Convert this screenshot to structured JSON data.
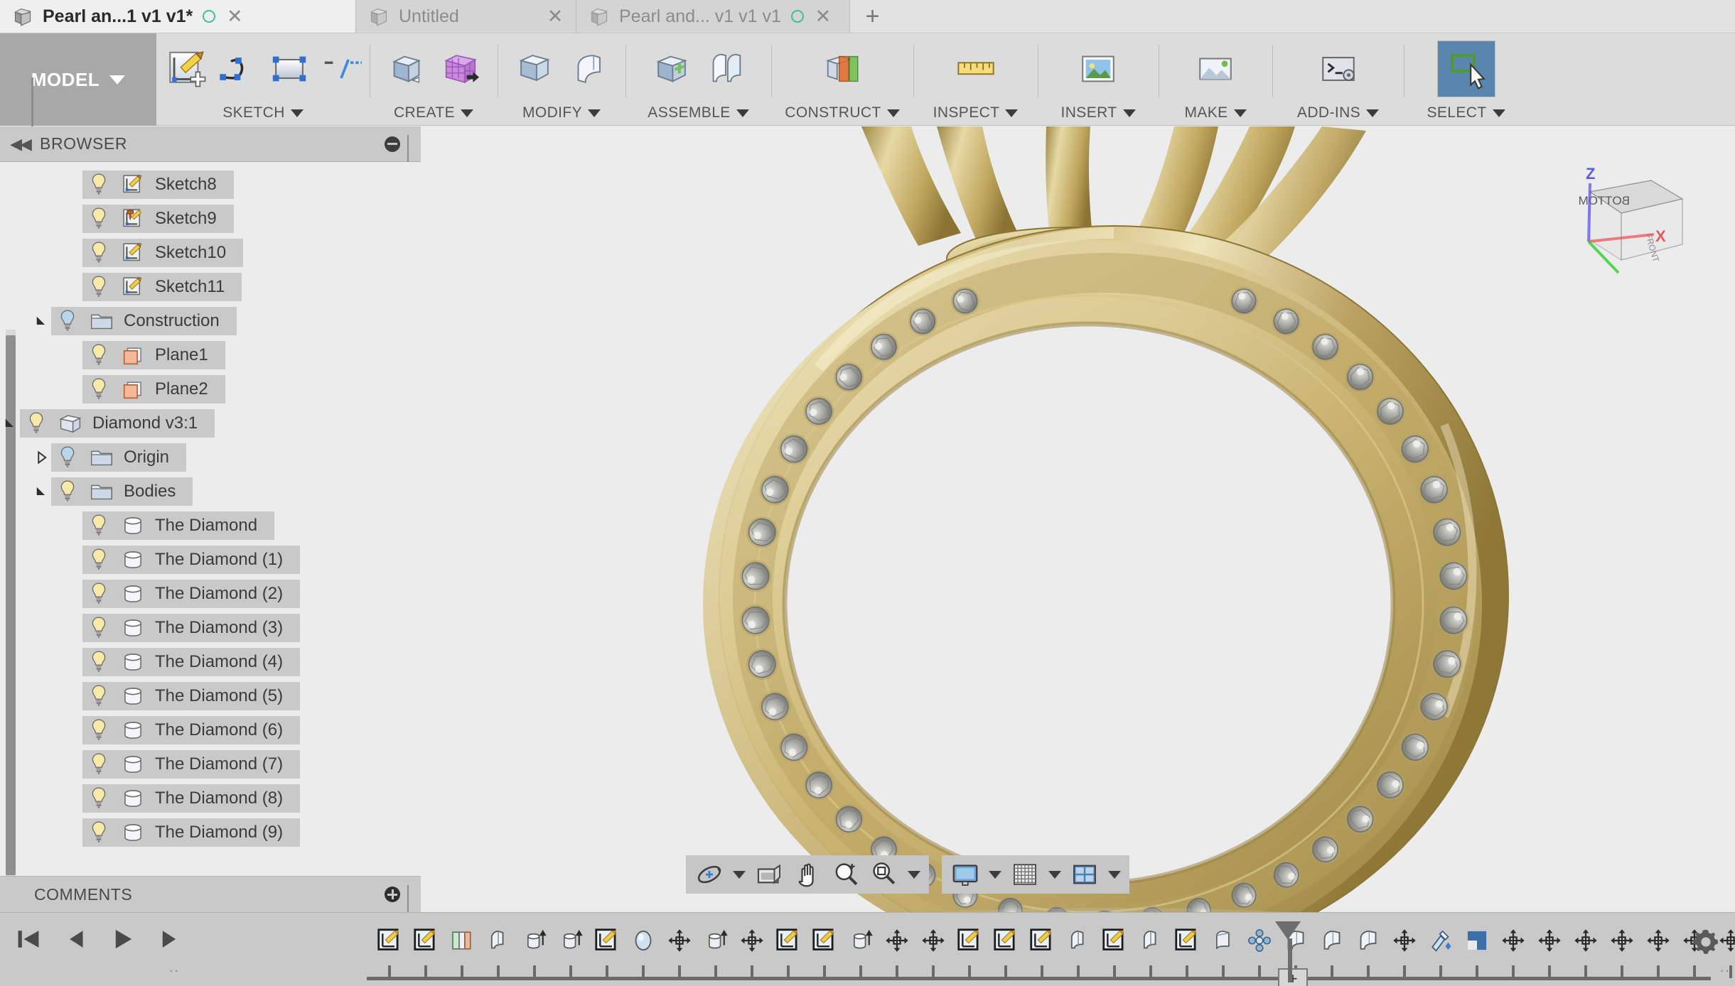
{
  "tabs": [
    {
      "title": "Pearl an...1 v1 v1*",
      "state": "active",
      "has_dot": true,
      "close": "✕"
    },
    {
      "title": "Untitled",
      "state": "inactive",
      "has_dot": false,
      "close": "✕"
    },
    {
      "title": "Pearl and... v1 v1 v1",
      "state": "inactive2",
      "has_dot": true,
      "close": "✕"
    }
  ],
  "tabbar": {
    "new_tab": "+"
  },
  "ribbon": {
    "workspace_label": "MODEL",
    "groups": [
      {
        "label": "SKETCH",
        "icons": [
          "create-sketch-icon",
          "spline-icon",
          "rectangle-icon",
          "sketch-dimension-icon"
        ]
      },
      {
        "label": "CREATE",
        "icons": [
          "extrude-icon",
          "pattern-icon"
        ]
      },
      {
        "label": "MODIFY",
        "icons": [
          "press-pull-icon",
          "fillet-icon"
        ]
      },
      {
        "label": "ASSEMBLE",
        "icons": [
          "new-component-icon",
          "joint-icon"
        ]
      },
      {
        "label": "CONSTRUCT",
        "icons": [
          "offset-plane-icon"
        ]
      },
      {
        "label": "INSPECT",
        "icons": [
          "measure-icon"
        ]
      },
      {
        "label": "INSERT",
        "icons": [
          "insert-mcmaster-icon"
        ]
      },
      {
        "label": "MAKE",
        "icons": [
          "3d-print-icon"
        ]
      },
      {
        "label": "ADD-INS",
        "icons": [
          "scripts-addins-icon"
        ]
      },
      {
        "label": "SELECT",
        "icons": [
          "select-window-icon"
        ]
      }
    ]
  },
  "browser": {
    "header": "BROWSER",
    "collapse_icon": "collapse-left-icon",
    "minimize_icon": "minimize-icon",
    "tree": [
      {
        "label": "Sketch8",
        "indent": 3,
        "icon": "sketch-icon",
        "bulb": "on",
        "arrow": "none"
      },
      {
        "label": "Sketch9",
        "indent": 3,
        "icon": "sketch-pin-icon",
        "bulb": "on",
        "arrow": "none"
      },
      {
        "label": "Sketch10",
        "indent": 3,
        "icon": "sketch-icon",
        "bulb": "on",
        "arrow": "none"
      },
      {
        "label": "Sketch11",
        "indent": 3,
        "icon": "sketch-icon",
        "bulb": "on",
        "arrow": "none"
      },
      {
        "label": "Construction",
        "indent": 2,
        "icon": "folder-icon",
        "bulb": "off",
        "arrow": "expanded"
      },
      {
        "label": "Plane1",
        "indent": 3,
        "icon": "plane-icon",
        "bulb": "on",
        "arrow": "none"
      },
      {
        "label": "Plane2",
        "indent": 3,
        "icon": "plane-icon",
        "bulb": "on",
        "arrow": "none"
      },
      {
        "label": "Diamond v3:1",
        "indent": 1,
        "icon": "component-icon",
        "bulb": "on",
        "arrow": "expanded"
      },
      {
        "label": "Origin",
        "indent": 2,
        "icon": "folder-icon",
        "bulb": "off",
        "arrow": "collapsed"
      },
      {
        "label": "Bodies",
        "indent": 2,
        "icon": "folder-icon",
        "bulb": "on",
        "arrow": "expanded"
      },
      {
        "label": "The Diamond",
        "indent": 3,
        "icon": "body-icon",
        "bulb": "on",
        "arrow": "none"
      },
      {
        "label": "The Diamond (1)",
        "indent": 3,
        "icon": "body-icon",
        "bulb": "on",
        "arrow": "none"
      },
      {
        "label": "The Diamond (2)",
        "indent": 3,
        "icon": "body-icon",
        "bulb": "on",
        "arrow": "none"
      },
      {
        "label": "The Diamond (3)",
        "indent": 3,
        "icon": "body-icon",
        "bulb": "on",
        "arrow": "none"
      },
      {
        "label": "The Diamond (4)",
        "indent": 3,
        "icon": "body-icon",
        "bulb": "on",
        "arrow": "none"
      },
      {
        "label": "The Diamond (5)",
        "indent": 3,
        "icon": "body-icon",
        "bulb": "on",
        "arrow": "none"
      },
      {
        "label": "The Diamond (6)",
        "indent": 3,
        "icon": "body-icon",
        "bulb": "on",
        "arrow": "none"
      },
      {
        "label": "The Diamond (7)",
        "indent": 3,
        "icon": "body-icon",
        "bulb": "on",
        "arrow": "none"
      },
      {
        "label": "The Diamond (8)",
        "indent": 3,
        "icon": "body-icon",
        "bulb": "on",
        "arrow": "none"
      },
      {
        "label": "The Diamond (9)",
        "indent": 3,
        "icon": "body-icon",
        "bulb": "on",
        "arrow": "none"
      }
    ]
  },
  "comments": {
    "header": "COMMENTS",
    "add_icon": "add-comment-icon"
  },
  "viewcube": {
    "face_label": "BOTTOM",
    "side_label": "FRONT",
    "axis_x": "X",
    "axis_z": "Z"
  },
  "navbar": {
    "groups": [
      {
        "buttons": [
          {
            "name": "orbit-icon",
            "caret": true
          },
          {
            "name": "look-at-icon",
            "caret": false
          },
          {
            "name": "pan-icon",
            "caret": false
          },
          {
            "name": "zoom-icon",
            "caret": false
          },
          {
            "name": "fit-icon",
            "caret": true
          }
        ]
      },
      {
        "buttons": [
          {
            "name": "display-settings-icon",
            "caret": true
          },
          {
            "name": "grid-snaps-icon",
            "caret": true
          },
          {
            "name": "viewports-icon",
            "caret": true
          }
        ]
      }
    ]
  },
  "timeline": {
    "playback": [
      "go-to-beginning-icon",
      "step-back-icon",
      "play-icon",
      "step-forward-icon",
      "go-to-end-icon"
    ],
    "marker_label": "+",
    "settings_icon": "timeline-settings-icon",
    "overflow_left": "..",
    "overflow_right": "..",
    "features": [
      {
        "icon": "sketch-icon",
        "highlight": false
      },
      {
        "icon": "sketch-icon",
        "highlight": false
      },
      {
        "icon": "revolve-icon",
        "highlight": false
      },
      {
        "icon": "split-face-icon",
        "highlight": false
      },
      {
        "icon": "extrude-icon",
        "highlight": false
      },
      {
        "icon": "extrude-icon",
        "highlight": false
      },
      {
        "icon": "sketch-icon",
        "highlight": false
      },
      {
        "icon": "sphere-icon",
        "highlight": false
      },
      {
        "icon": "move-icon",
        "highlight": false
      },
      {
        "icon": "extrude-icon",
        "highlight": false
      },
      {
        "icon": "move-icon",
        "highlight": false
      },
      {
        "icon": "sketch-icon",
        "highlight": false
      },
      {
        "icon": "sketch-icon",
        "highlight": false
      },
      {
        "icon": "extrude-icon",
        "highlight": false
      },
      {
        "icon": "move-icon",
        "highlight": false
      },
      {
        "icon": "move-icon",
        "highlight": false
      },
      {
        "icon": "sketch-icon",
        "highlight": false
      },
      {
        "icon": "sketch-icon",
        "highlight": false
      },
      {
        "icon": "sketch-icon",
        "highlight": false
      },
      {
        "icon": "split-face-icon",
        "highlight": false
      },
      {
        "icon": "sketch-icon",
        "highlight": false
      },
      {
        "icon": "split-face-icon",
        "highlight": false
      },
      {
        "icon": "sketch-icon",
        "highlight": false
      },
      {
        "icon": "loft-icon",
        "highlight": false
      },
      {
        "icon": "pattern-icon",
        "highlight": false
      },
      {
        "icon": "fillet-icon",
        "highlight": false
      },
      {
        "icon": "fillet-icon",
        "highlight": false
      },
      {
        "icon": "fillet-icon",
        "highlight": false
      },
      {
        "icon": "move-icon",
        "highlight": false
      },
      {
        "icon": "appearance-icon",
        "highlight": false
      },
      {
        "icon": "shell-icon",
        "highlight": false
      },
      {
        "icon": "move-icon",
        "highlight": false
      },
      {
        "icon": "move-icon",
        "highlight": false
      },
      {
        "icon": "move-icon",
        "highlight": false
      },
      {
        "icon": "move-icon",
        "highlight": false
      },
      {
        "icon": "move-icon",
        "highlight": false
      },
      {
        "icon": "move-icon",
        "highlight": false
      },
      {
        "icon": "move-icon",
        "highlight": false
      },
      {
        "icon": "move-icon",
        "highlight": false
      },
      {
        "icon": "move-icon",
        "highlight": false
      },
      {
        "icon": "move-icon",
        "highlight": false
      },
      {
        "icon": "move-icon",
        "highlight": false
      },
      {
        "icon": "move-icon",
        "highlight": false
      },
      {
        "icon": "pattern-icon",
        "highlight": true
      },
      {
        "icon": "revolve-icon",
        "highlight": false
      },
      {
        "icon": "mirror-icon",
        "highlight": false
      }
    ]
  },
  "colors": {
    "ribbon_bg": "#dcdcdc",
    "panel_bg": "#ececec",
    "header_bg": "#c9c9c9",
    "accent_green": "#3fbf9a",
    "timeline_highlight": "#f5f514",
    "gold_light": "#e3d28a",
    "gold_mid": "#c3ab5f",
    "gold_dark": "#8e7a3a",
    "gem_gray": "#9a9a96",
    "select_blue": "#5a86ad"
  }
}
